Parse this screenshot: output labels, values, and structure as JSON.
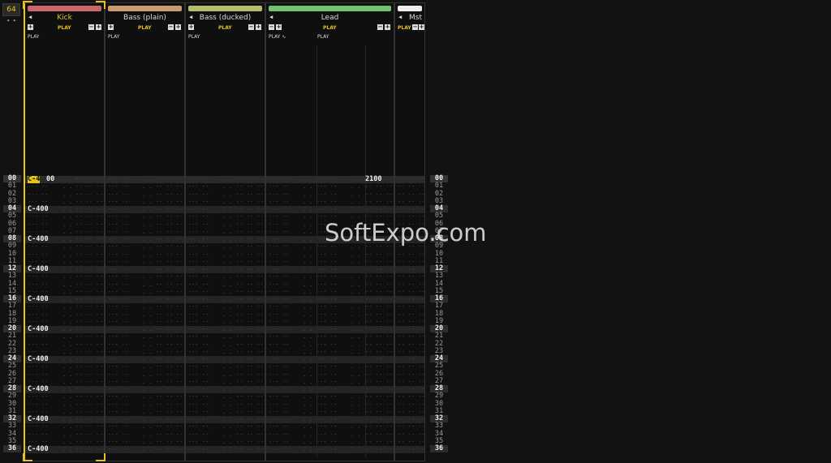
{
  "lines_per_pattern": "64",
  "lpp_arrows": "◂ ▸",
  "tracks": [
    {
      "name": "Kick",
      "color": "#c9676a",
      "play": "PLAY",
      "mini": [
        "+",
        "−",
        "+"
      ]
    },
    {
      "name": "Bass (plain)",
      "color": "#c99a6e",
      "play": "PLAY",
      "mini": [
        "+",
        "−",
        "+"
      ]
    },
    {
      "name": "Bass (ducked)",
      "color": "#b7bb6f",
      "play": "PLAY",
      "mini": [
        "+",
        "−",
        "+"
      ]
    },
    {
      "name": "Lead",
      "color": "#6fc36c",
      "play": "PLAY",
      "play2": "PLAY",
      "play_wave": "PLAY ∿",
      "mini": [
        "−",
        "+",
        "−",
        "+"
      ]
    },
    {
      "name": "Mst",
      "color": "#ededed",
      "play": "PLAY",
      "mini": [
        "−",
        "+"
      ]
    }
  ],
  "row_numbers": [
    "00",
    "01",
    "02",
    "03",
    "04",
    "05",
    "06",
    "07",
    "08",
    "09",
    "10",
    "11",
    "12",
    "13",
    "14",
    "15",
    "16",
    "17",
    "18",
    "19",
    "20",
    "21",
    "22",
    "23",
    "24",
    "25",
    "26",
    "27",
    "28",
    "29",
    "30",
    "31",
    "32",
    "33",
    "34",
    "35",
    "36"
  ],
  "kick_note": "C-400",
  "kick_note_first_a": "C-4",
  "kick_note_first_b": "00",
  "lead_first_value": "2100",
  "empty_cell": "-- -- --",
  "empty_note": "--- --",
  "dots": ". .",
  "watermark": "SoftExpo.com"
}
